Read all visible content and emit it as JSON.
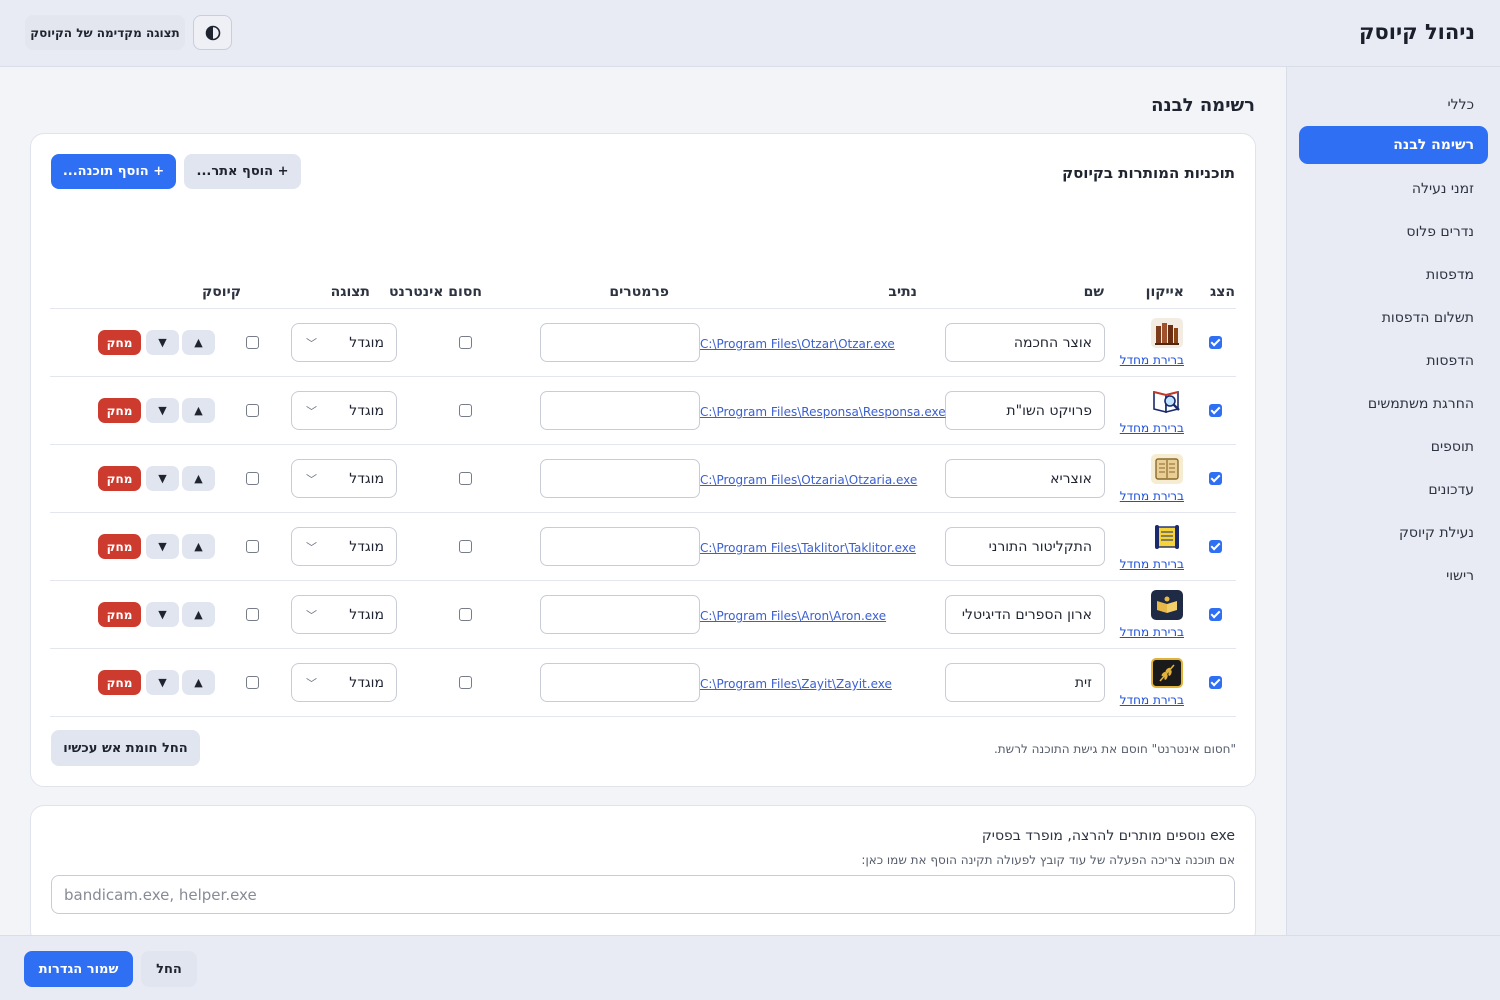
{
  "header": {
    "title": "ניהול קיוסק",
    "preview_label": "תצוגה מקדימה של הקיוסק",
    "theme_icon": "contrast-icon"
  },
  "sidebar": {
    "items": [
      {
        "label": "כללי"
      },
      {
        "label": "רשימה לבנה",
        "active": true
      },
      {
        "label": "זמני נעילה"
      },
      {
        "label": "נדרים פלוס"
      },
      {
        "label": "מדפסות"
      },
      {
        "label": "תשלום הדפסות"
      },
      {
        "label": "הדפסות"
      },
      {
        "label": "החרגת משתמשים"
      },
      {
        "label": "תוספים"
      },
      {
        "label": "עדכונים"
      },
      {
        "label": "נעילת קיוסק"
      },
      {
        "label": "רישוי"
      }
    ]
  },
  "main": {
    "title": "רשימה לבנה",
    "card_title": "תוכניות המותרות בקיוסק",
    "add_program_label": "+ הוסף תוכנה...",
    "add_site_label": "+ הוסף אתר...",
    "columns": {
      "show": "הצג",
      "icon": "אייקון",
      "name": "שם",
      "path": "נתיב",
      "params": "פרמטרים",
      "block_internet": "חסום אינטרנט",
      "display": "תצוגה",
      "kiosk": "קיוסק"
    },
    "rows": [
      {
        "show": true,
        "icon": "books-icon",
        "icon_link": "ברירת מחדל",
        "name": "אוצר החכמה",
        "path": "C:\\Program Files\\Otzar\\Otzar.exe",
        "params": "",
        "block_internet": false,
        "display": "מוגדל",
        "kiosk": false
      },
      {
        "show": true,
        "icon": "book-magnifier-icon",
        "icon_link": "ברירת מחדל",
        "name": "פרויקט השו\"ת",
        "path": "C:\\Program Files\\Responsa\\Responsa.exe",
        "params": "",
        "block_internet": false,
        "display": "מוגדל",
        "kiosk": false
      },
      {
        "show": true,
        "icon": "open-book-icon",
        "icon_link": "ברירת מחדל",
        "name": "אוצריא",
        "path": "C:\\Program Files\\Otzaria\\Otzaria.exe",
        "params": "",
        "block_internet": false,
        "display": "מוגדל",
        "kiosk": false
      },
      {
        "show": true,
        "icon": "torah-scroll-icon",
        "icon_link": "ברירת מחדל",
        "name": "התקליטור התורני",
        "path": "C:\\Program Files\\Taklitor\\Taklitor.exe",
        "params": "",
        "block_internet": false,
        "display": "מוגדל",
        "kiosk": false
      },
      {
        "show": true,
        "icon": "digital-bookshelf-icon",
        "icon_link": "ברירת מחדל",
        "name": "ארון הספרים הדיגיטלי",
        "path": "C:\\Program Files\\Aron\\Aron.exe",
        "params": "",
        "block_internet": false,
        "display": "מוגדל",
        "kiosk": false
      },
      {
        "show": true,
        "icon": "olive-branch-icon",
        "icon_link": "ברירת מחדל",
        "name": "זית",
        "path": "C:\\Program Files\\Zayit\\Zayit.exe",
        "params": "",
        "block_internet": false,
        "display": "מוגדל",
        "kiosk": false
      }
    ],
    "row_actions": {
      "up": "▲",
      "down": "▼",
      "delete": "מחק"
    },
    "note": "\"חסום אינטרנט\" חוסם את גישת התוכנה לרשת.",
    "firewall_label": "החל חומת אש עכשיו"
  },
  "extra_exe": {
    "label": "exe נוספים מותרים להרצה, מופרד בפסיק",
    "sublabel": "אם תוכנה צריכה הפעלה של עוד קובץ לפעולה תקינה הוסף את שמו כאן:",
    "placeholder": "bandicam.exe, helper.exe"
  },
  "footer": {
    "save_label": "שמור הגדרות",
    "apply_label": "החל"
  },
  "colors": {
    "accent": "#2f6ff3",
    "danger": "#cd3a2e",
    "link": "#1d4fd8"
  }
}
